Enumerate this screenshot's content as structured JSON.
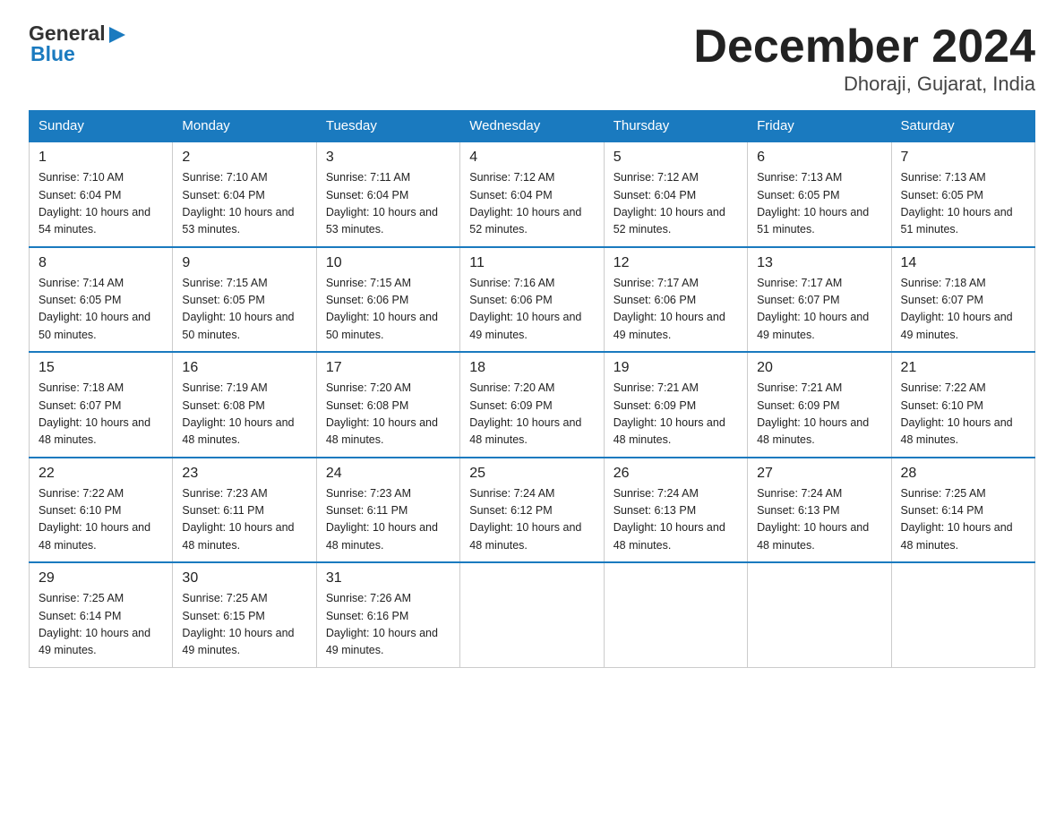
{
  "logo": {
    "text_general": "General",
    "text_blue": "Blue",
    "arrow": "▶"
  },
  "title": "December 2024",
  "subtitle": "Dhoraji, Gujarat, India",
  "days_of_week": [
    "Sunday",
    "Monday",
    "Tuesday",
    "Wednesday",
    "Thursday",
    "Friday",
    "Saturday"
  ],
  "weeks": [
    [
      {
        "num": "1",
        "sunrise": "7:10 AM",
        "sunset": "6:04 PM",
        "daylight": "10 hours and 54 minutes."
      },
      {
        "num": "2",
        "sunrise": "7:10 AM",
        "sunset": "6:04 PM",
        "daylight": "10 hours and 53 minutes."
      },
      {
        "num": "3",
        "sunrise": "7:11 AM",
        "sunset": "6:04 PM",
        "daylight": "10 hours and 53 minutes."
      },
      {
        "num": "4",
        "sunrise": "7:12 AM",
        "sunset": "6:04 PM",
        "daylight": "10 hours and 52 minutes."
      },
      {
        "num": "5",
        "sunrise": "7:12 AM",
        "sunset": "6:04 PM",
        "daylight": "10 hours and 52 minutes."
      },
      {
        "num": "6",
        "sunrise": "7:13 AM",
        "sunset": "6:05 PM",
        "daylight": "10 hours and 51 minutes."
      },
      {
        "num": "7",
        "sunrise": "7:13 AM",
        "sunset": "6:05 PM",
        "daylight": "10 hours and 51 minutes."
      }
    ],
    [
      {
        "num": "8",
        "sunrise": "7:14 AM",
        "sunset": "6:05 PM",
        "daylight": "10 hours and 50 minutes."
      },
      {
        "num": "9",
        "sunrise": "7:15 AM",
        "sunset": "6:05 PM",
        "daylight": "10 hours and 50 minutes."
      },
      {
        "num": "10",
        "sunrise": "7:15 AM",
        "sunset": "6:06 PM",
        "daylight": "10 hours and 50 minutes."
      },
      {
        "num": "11",
        "sunrise": "7:16 AM",
        "sunset": "6:06 PM",
        "daylight": "10 hours and 49 minutes."
      },
      {
        "num": "12",
        "sunrise": "7:17 AM",
        "sunset": "6:06 PM",
        "daylight": "10 hours and 49 minutes."
      },
      {
        "num": "13",
        "sunrise": "7:17 AM",
        "sunset": "6:07 PM",
        "daylight": "10 hours and 49 minutes."
      },
      {
        "num": "14",
        "sunrise": "7:18 AM",
        "sunset": "6:07 PM",
        "daylight": "10 hours and 49 minutes."
      }
    ],
    [
      {
        "num": "15",
        "sunrise": "7:18 AM",
        "sunset": "6:07 PM",
        "daylight": "10 hours and 48 minutes."
      },
      {
        "num": "16",
        "sunrise": "7:19 AM",
        "sunset": "6:08 PM",
        "daylight": "10 hours and 48 minutes."
      },
      {
        "num": "17",
        "sunrise": "7:20 AM",
        "sunset": "6:08 PM",
        "daylight": "10 hours and 48 minutes."
      },
      {
        "num": "18",
        "sunrise": "7:20 AM",
        "sunset": "6:09 PM",
        "daylight": "10 hours and 48 minutes."
      },
      {
        "num": "19",
        "sunrise": "7:21 AM",
        "sunset": "6:09 PM",
        "daylight": "10 hours and 48 minutes."
      },
      {
        "num": "20",
        "sunrise": "7:21 AM",
        "sunset": "6:09 PM",
        "daylight": "10 hours and 48 minutes."
      },
      {
        "num": "21",
        "sunrise": "7:22 AM",
        "sunset": "6:10 PM",
        "daylight": "10 hours and 48 minutes."
      }
    ],
    [
      {
        "num": "22",
        "sunrise": "7:22 AM",
        "sunset": "6:10 PM",
        "daylight": "10 hours and 48 minutes."
      },
      {
        "num": "23",
        "sunrise": "7:23 AM",
        "sunset": "6:11 PM",
        "daylight": "10 hours and 48 minutes."
      },
      {
        "num": "24",
        "sunrise": "7:23 AM",
        "sunset": "6:11 PM",
        "daylight": "10 hours and 48 minutes."
      },
      {
        "num": "25",
        "sunrise": "7:24 AM",
        "sunset": "6:12 PM",
        "daylight": "10 hours and 48 minutes."
      },
      {
        "num": "26",
        "sunrise": "7:24 AM",
        "sunset": "6:13 PM",
        "daylight": "10 hours and 48 minutes."
      },
      {
        "num": "27",
        "sunrise": "7:24 AM",
        "sunset": "6:13 PM",
        "daylight": "10 hours and 48 minutes."
      },
      {
        "num": "28",
        "sunrise": "7:25 AM",
        "sunset": "6:14 PM",
        "daylight": "10 hours and 48 minutes."
      }
    ],
    [
      {
        "num": "29",
        "sunrise": "7:25 AM",
        "sunset": "6:14 PM",
        "daylight": "10 hours and 49 minutes."
      },
      {
        "num": "30",
        "sunrise": "7:25 AM",
        "sunset": "6:15 PM",
        "daylight": "10 hours and 49 minutes."
      },
      {
        "num": "31",
        "sunrise": "7:26 AM",
        "sunset": "6:16 PM",
        "daylight": "10 hours and 49 minutes."
      },
      null,
      null,
      null,
      null
    ]
  ]
}
